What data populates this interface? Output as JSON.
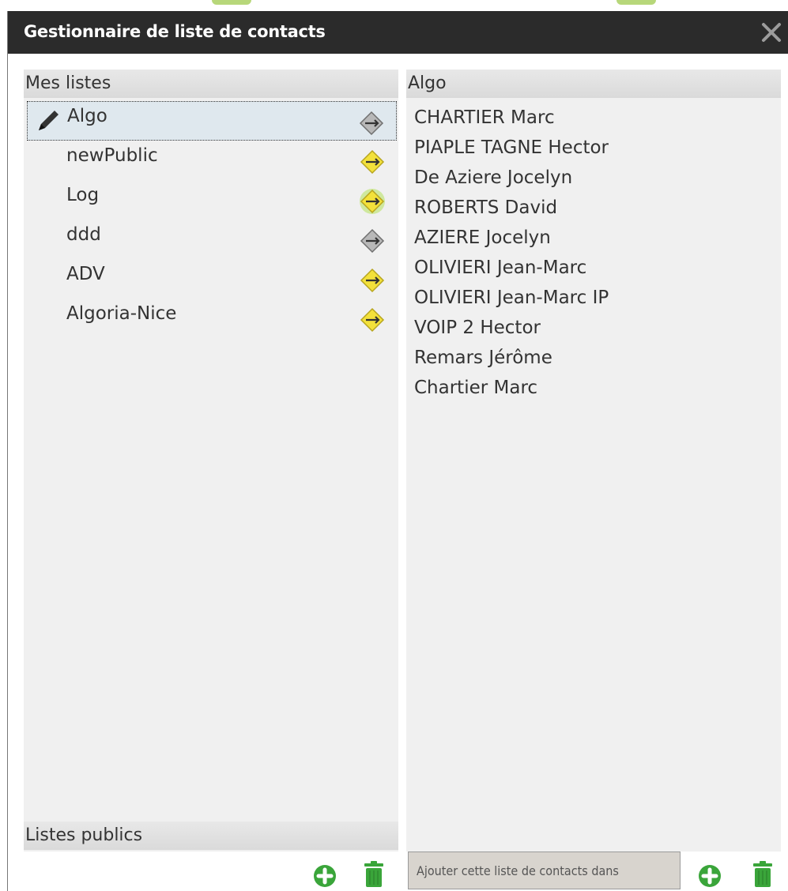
{
  "dialog": {
    "title": "Gestionnaire de liste de contacts"
  },
  "left": {
    "header": "Mes listes",
    "footer_header": "Listes publics",
    "lists": [
      {
        "label": "Algo",
        "selected": true,
        "share_state": "grey"
      },
      {
        "label": "newPublic",
        "selected": false,
        "share_state": "yellow"
      },
      {
        "label": "Log",
        "selected": false,
        "share_state": "yellow-green"
      },
      {
        "label": "ddd",
        "selected": false,
        "share_state": "grey"
      },
      {
        "label": "ADV",
        "selected": false,
        "share_state": "yellow"
      },
      {
        "label": "Algoria-Nice",
        "selected": false,
        "share_state": "yellow"
      }
    ]
  },
  "right": {
    "header": "Algo",
    "contacts": [
      "CHARTIER Marc",
      "PIAPLE TAGNE Hector",
      "De Aziere Jocelyn",
      "ROBERTS David",
      "AZIERE Jocelyn",
      "OLIVIERI Jean-Marc",
      "OLIVIERI Jean-Marc IP",
      "VOIP 2 Hector",
      "Remars Jérôme",
      "Chartier Marc"
    ],
    "add_to_button": "Ajouter cette liste de contacts dans"
  },
  "colors": {
    "titlebar": "#2b2b2b",
    "panel": "#f0f0f0",
    "accent_green": "#3aa53a",
    "share_yellow": "#f3e13b",
    "share_grey": "#9a9a9a"
  },
  "icons": {
    "close": "close-icon",
    "pencil": "pencil-icon",
    "share": "share-toggle-icon",
    "add": "add-circle-icon",
    "trash": "trash-icon"
  }
}
